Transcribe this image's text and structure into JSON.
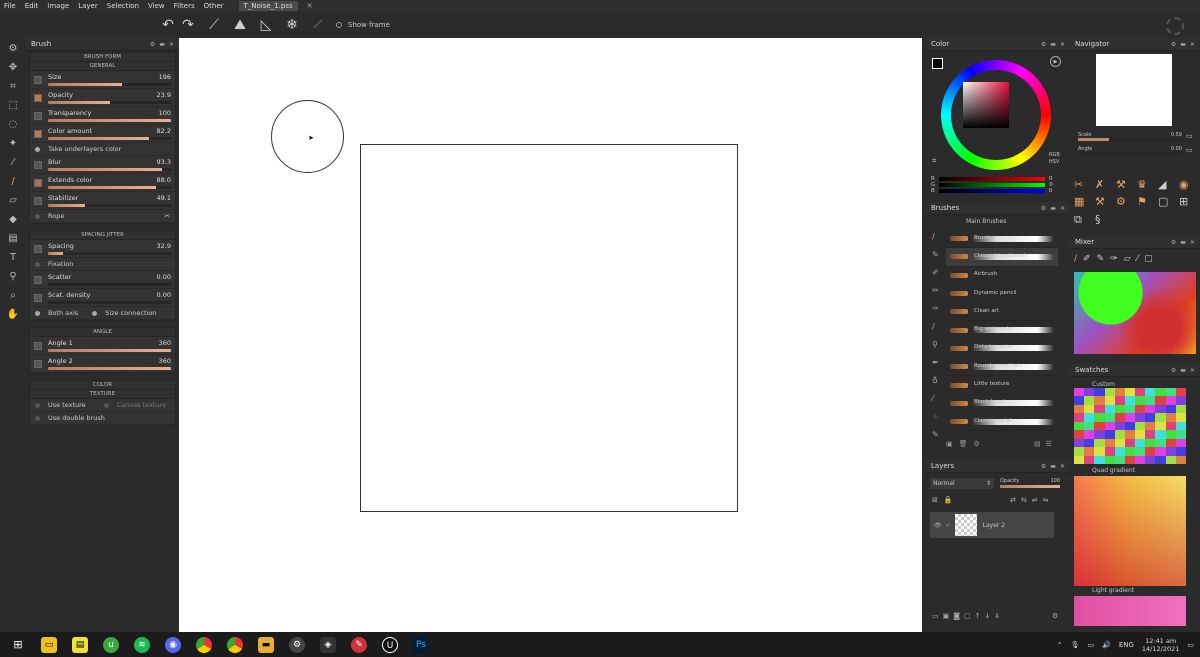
{
  "menu": [
    "File",
    "Edit",
    "Image",
    "Layer",
    "Selection",
    "View",
    "Filters",
    "Other"
  ],
  "document_tab": "T_Noise_1.pss",
  "toolbar": {
    "show_frame": "Show frame"
  },
  "brush_panel": {
    "title": "Brush",
    "brush_form": "BRUSH FORM",
    "general": "GENERAL",
    "params": [
      {
        "label": "Size",
        "value": "196",
        "fill": 0.6
      },
      {
        "label": "Opacity",
        "value": "23.9",
        "fill": 0.5
      },
      {
        "label": "Transparency",
        "value": "100",
        "fill": 1.0
      },
      {
        "label": "Color amount",
        "value": "82.2",
        "fill": 0.82
      }
    ],
    "take_underlayers": "Take underlayers color",
    "params2": [
      {
        "label": "Blur",
        "value": "93.3",
        "fill": 0.93
      },
      {
        "label": "Extends color",
        "value": "88.0",
        "fill": 0.88
      },
      {
        "label": "Stabilizer",
        "value": "49.1",
        "fill": 0.3
      }
    ],
    "rope": "Rope",
    "spacing_jitter": "SPACING JITTER",
    "spacing": {
      "label": "Spacing",
      "value": "32.9",
      "fill": 0.12
    },
    "fixation": "Fixation",
    "scatter": {
      "label": "Scatter",
      "value": "0.00",
      "fill": 0.0
    },
    "scat_density": {
      "label": "Scat. density",
      "value": "0.00",
      "fill": 0.0
    },
    "both_axis": "Both axis",
    "size_connection": "Size connection",
    "angle": "ANGLE",
    "angle1": {
      "label": "Angle 1",
      "value": "360",
      "fill": 1.0
    },
    "angle2": {
      "label": "Angle 2",
      "value": "360",
      "fill": 1.0
    },
    "color": "COLOR",
    "texture": "TEXTURE",
    "use_texture": "Use texture",
    "canvas_texture": "Canvas texture",
    "use_double_brush": "Use double brush"
  },
  "color_panel": {
    "title": "Color",
    "mode1": "RGB",
    "mode2": "HSV",
    "r": "R",
    "g": "G",
    "b": "B",
    "r_val": "0",
    "g_val": "0",
    "b_val": "0"
  },
  "brushes_panel": {
    "title": "Brushes",
    "group": "Main Brushes",
    "items": [
      "Brush",
      "Classic blend brush",
      "Airbrush",
      "Dynamic pencil",
      "Clean art",
      "Big watercolor",
      "Dirty impasto",
      "Round camel hair",
      "Little texture",
      "Block brush",
      "Classic pastel"
    ]
  },
  "layers_panel": {
    "title": "Layers",
    "blend": "Normal",
    "opacity_label": "Opacity",
    "opacity_value": "100",
    "layer_name": "Layer 2"
  },
  "navigator": {
    "title": "Navigator",
    "scale_label": "Scale",
    "scale_value": "0.59",
    "angle_label": "Angle",
    "angle_value": "0.00"
  },
  "mixer": {
    "title": "Mixer"
  },
  "swatches": {
    "title": "Swatches",
    "custom": "Custom",
    "quad": "Quad gradient",
    "light": "Light gradient"
  },
  "taskbar": {
    "lang": "ENG",
    "time": "12:41 am",
    "date": "14/12/2021"
  }
}
